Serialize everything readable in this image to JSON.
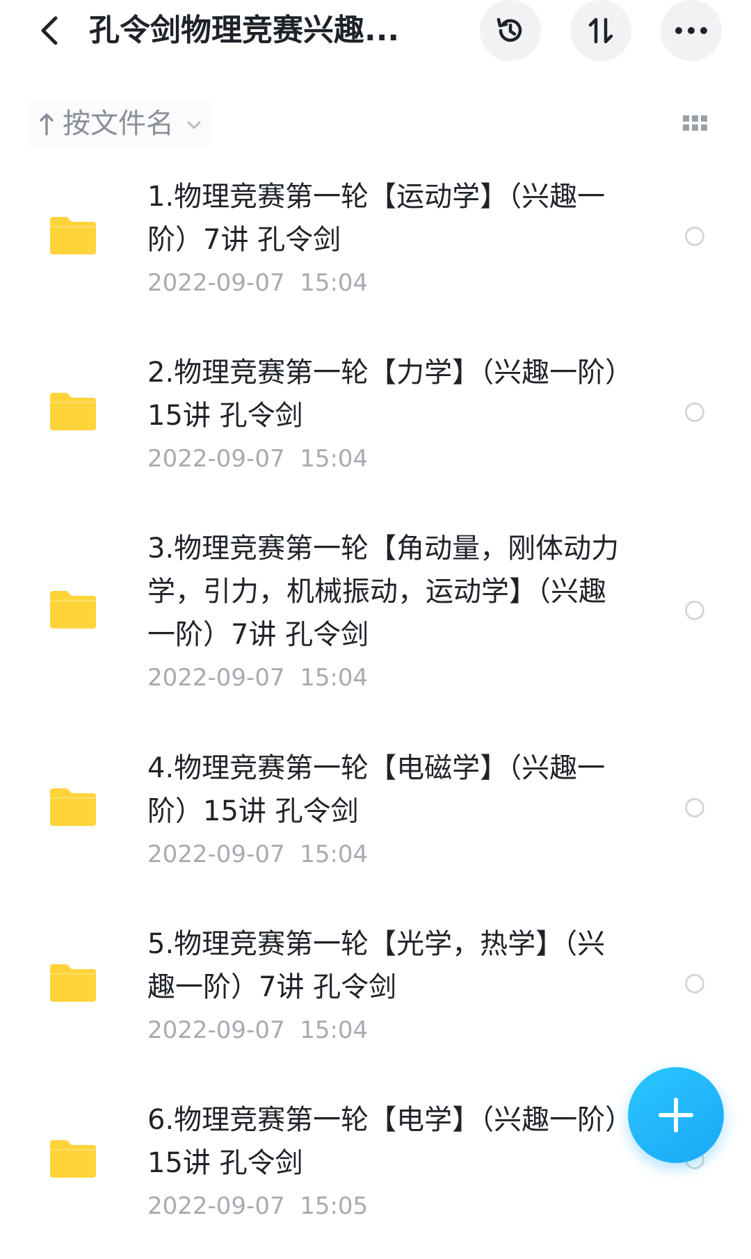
{
  "header": {
    "title": "孔令剑物理竞赛兴趣...",
    "back_icon": "chevron-left-icon",
    "history_icon": "history-icon",
    "sort_icon": "sort-arrows-icon",
    "more_icon": "more-horizontal-icon"
  },
  "sortbar": {
    "label": "按文件名",
    "arrow_icon": "arrow-up-icon",
    "chevron_icon": "chevron-down-icon",
    "view_toggle_icon": "grid-view-icon"
  },
  "files": [
    {
      "name": "1.物理竞赛第一轮【运动学】（兴趣一阶）7讲 孔令剑",
      "date": "2022-09-07  15:04"
    },
    {
      "name": "2.物理竞赛第一轮【力学】（兴趣一阶）15讲 孔令剑",
      "date": "2022-09-07  15:04"
    },
    {
      "name": "3.物理竞赛第一轮【角动量，刚体动力学，引力，机械振动，运动学】（兴趣一阶）7讲 孔令剑",
      "date": "2022-09-07  15:04"
    },
    {
      "name": "4.物理竞赛第一轮【电磁学】（兴趣一阶）15讲 孔令剑",
      "date": "2022-09-07  15:04"
    },
    {
      "name": "5.物理竞赛第一轮【光学，热学】（兴趣一阶）7讲 孔令剑",
      "date": "2022-09-07  15:04"
    },
    {
      "name": "6.物理竞赛第一轮【电学】（兴趣一阶）15讲 孔令剑",
      "date": "2022-09-07  15:05"
    }
  ],
  "fab": {
    "icon": "plus-icon"
  },
  "colors": {
    "folder": "#ffd43b",
    "accent": "#1aa8f7",
    "text_primary": "#1f2329",
    "text_secondary": "#a6abb3"
  }
}
